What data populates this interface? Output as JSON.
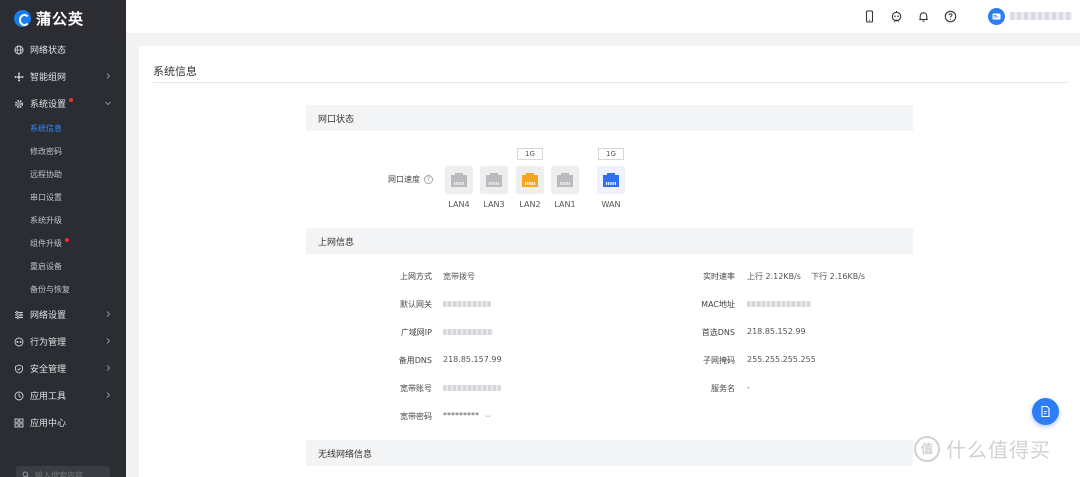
{
  "brand": {
    "name": "蒲公英"
  },
  "sidebar": {
    "items": [
      {
        "label": "网络状态",
        "icon": "globe-icon",
        "expandable": false
      },
      {
        "label": "智能组网",
        "icon": "network-icon",
        "expandable": true
      },
      {
        "label": "系统设置",
        "icon": "gear-icon",
        "expandable": true,
        "expanded": true,
        "badge": true,
        "children": [
          {
            "label": "系统信息",
            "active": true
          },
          {
            "label": "修改密码"
          },
          {
            "label": "远程协助"
          },
          {
            "label": "串口设置"
          },
          {
            "label": "系统升级"
          },
          {
            "label": "组件升级",
            "badge": true
          },
          {
            "label": "重启设备"
          },
          {
            "label": "备份与恢复"
          }
        ]
      },
      {
        "label": "网络设置",
        "icon": "sliders-icon",
        "expandable": true
      },
      {
        "label": "行为管理",
        "icon": "behavior-icon",
        "expandable": true
      },
      {
        "label": "安全管理",
        "icon": "shield-icon",
        "expandable": true
      },
      {
        "label": "应用工具",
        "icon": "toolbox-icon",
        "expandable": true
      },
      {
        "label": "应用中心",
        "icon": "apps-grid-icon",
        "expandable": false
      }
    ],
    "search_placeholder": "输入搜索内容"
  },
  "topbar": {
    "icons": [
      "mobile-icon",
      "robot-icon",
      "bell-icon",
      "help-icon"
    ],
    "avatar_icon": "user-card-icon"
  },
  "page": {
    "title": "系统信息",
    "port_section": {
      "title": "网口状态",
      "speed_label": "网口速度",
      "help_glyph": "?",
      "ports": [
        {
          "name": "LAN4",
          "state": "inactive",
          "speed": ""
        },
        {
          "name": "LAN3",
          "state": "inactive",
          "speed": ""
        },
        {
          "name": "LAN2",
          "state": "active-lan",
          "speed": "1G"
        },
        {
          "name": "LAN1",
          "state": "inactive",
          "speed": ""
        },
        {
          "name": "WAN",
          "state": "active-wan",
          "speed": "1G"
        }
      ],
      "colors": {
        "inactive": "#b9bbbf",
        "active-lan": "#f5a623",
        "active-wan": "#2f6ff0"
      }
    },
    "internet_section": {
      "title": "上网信息",
      "left": [
        {
          "label": "上网方式",
          "value": "宽带拨号"
        },
        {
          "label": "默认网关",
          "value": ""
        },
        {
          "label": "广域网IP",
          "value": ""
        },
        {
          "label": "备用DNS",
          "value": "218.85.157.99"
        },
        {
          "label": "宽带账号",
          "value": ""
        },
        {
          "label": "宽带密码",
          "value": "*********"
        }
      ],
      "right": [
        {
          "label": "实时速率",
          "value": "上行 2.12KB/s    下行 2.16KB/s"
        },
        {
          "label": "MAC地址",
          "value": ""
        },
        {
          "label": "首选DNS",
          "value": "218.85.152.99"
        },
        {
          "label": "子网掩码",
          "value": "255.255.255.255"
        },
        {
          "label": "服务名",
          "value": "-"
        }
      ]
    },
    "wireless_section": {
      "title": "无线网络信息"
    }
  },
  "fab": {
    "icon": "document-edit-icon"
  },
  "watermark": {
    "mark": "值",
    "text": "什么值得买"
  }
}
